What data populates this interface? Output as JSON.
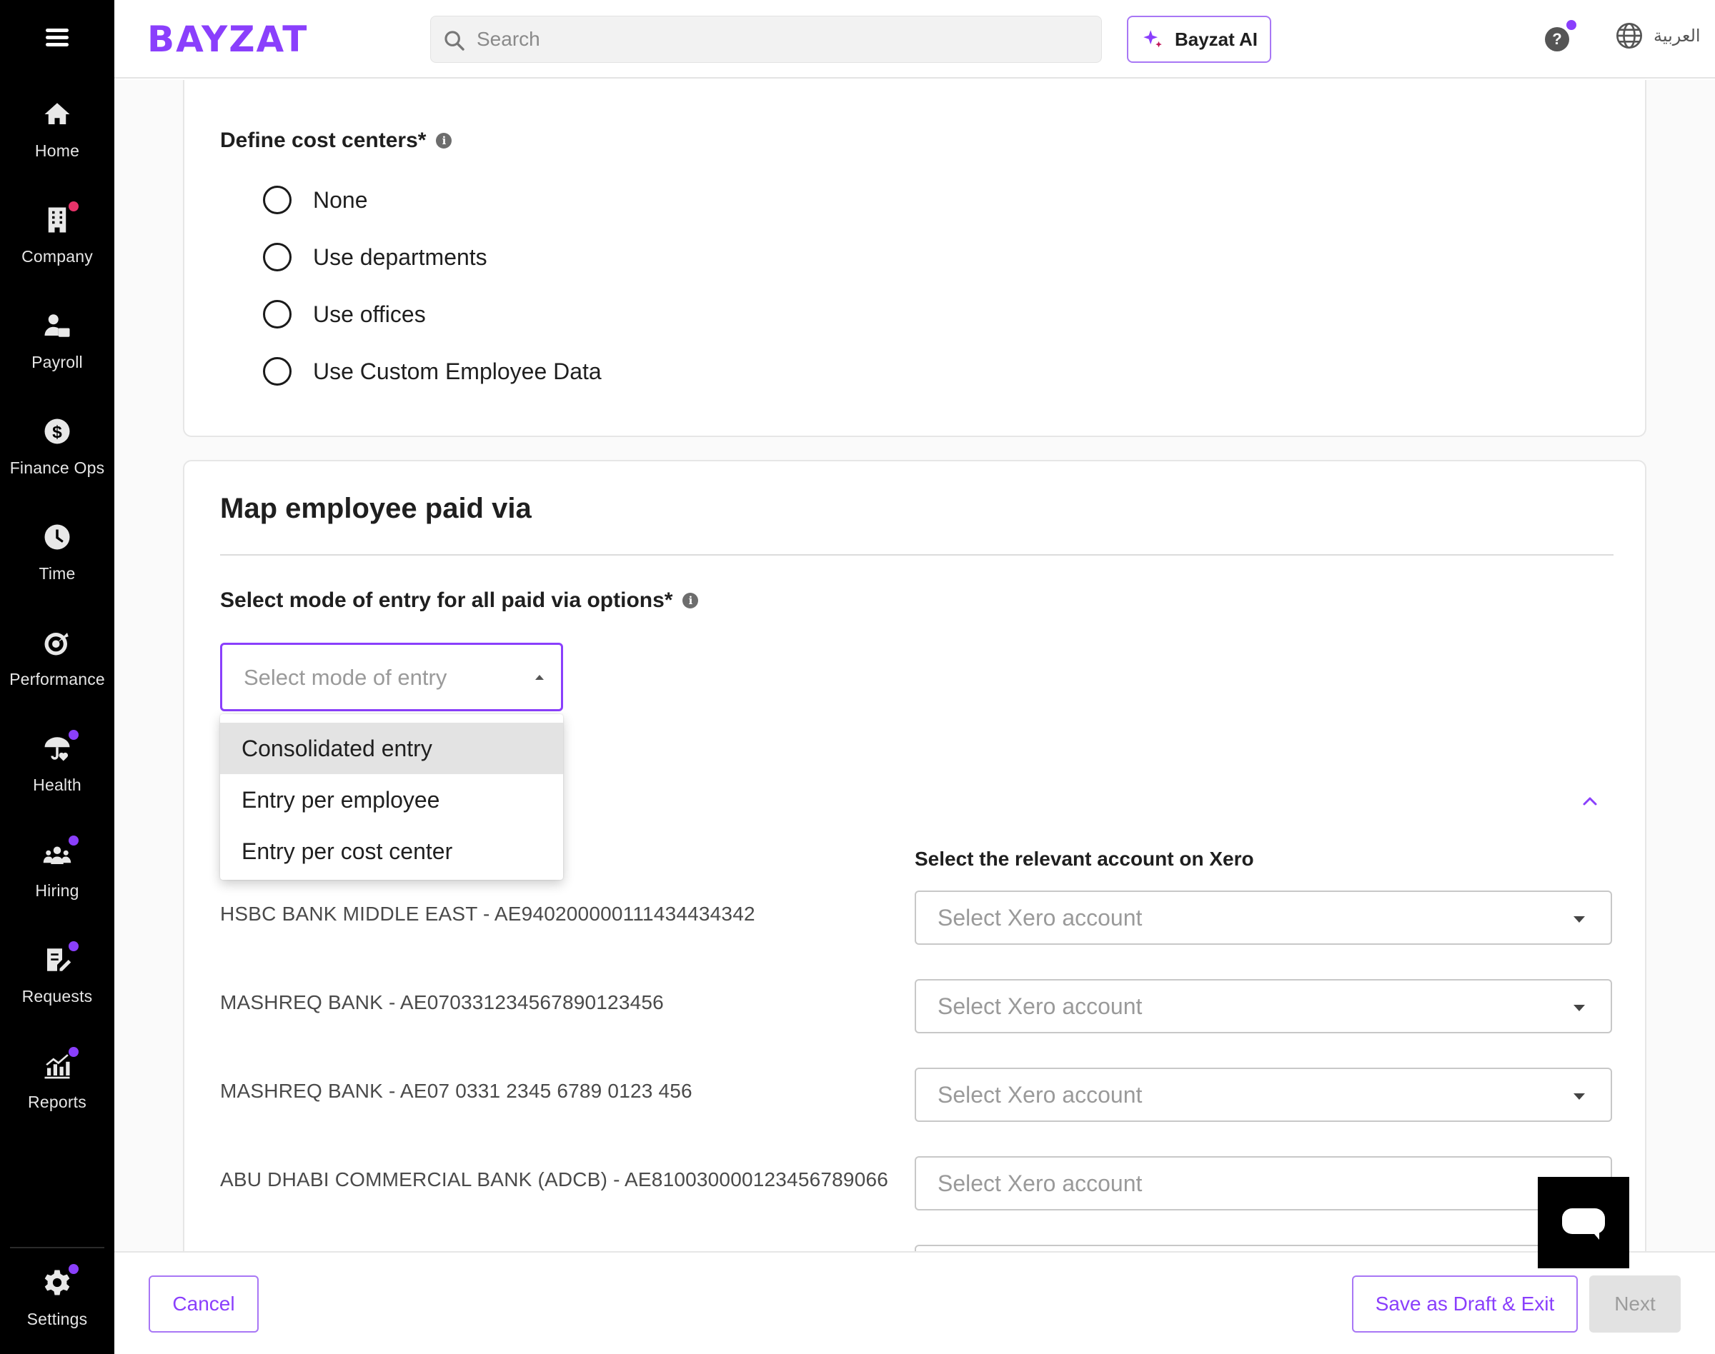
{
  "app": {
    "logo": "BAYZAT"
  },
  "sidebar": {
    "items": [
      {
        "label": "Home",
        "icon": "home-icon"
      },
      {
        "label": "Company",
        "icon": "building-icon",
        "badge": "#e8336a"
      },
      {
        "label": "Payroll",
        "icon": "payroll-icon"
      },
      {
        "label": "Finance Ops",
        "icon": "dollar-icon"
      },
      {
        "label": "Time",
        "icon": "clock-icon"
      },
      {
        "label": "Performance",
        "icon": "target-icon"
      },
      {
        "label": "Health",
        "icon": "umbrella-heart-icon",
        "badge": "#8a3ffc"
      },
      {
        "label": "Hiring",
        "icon": "people-icon",
        "badge": "#8a3ffc"
      },
      {
        "label": "Requests",
        "icon": "clipboard-icon",
        "badge": "#8a3ffc"
      },
      {
        "label": "Reports",
        "icon": "chart-icon",
        "badge": "#8a3ffc"
      }
    ],
    "settings": {
      "label": "Settings",
      "icon": "gear-icon"
    }
  },
  "topbar": {
    "search_placeholder": "Search",
    "ai_label": "Bayzat AI",
    "help_label": "?",
    "language_label": "العربية"
  },
  "cost_centers": {
    "label": "Define cost centers*",
    "options": [
      "None",
      "Use departments",
      "Use offices",
      "Use Custom Employee Data"
    ]
  },
  "paid_via": {
    "title": "Map employee paid via",
    "mode_label": "Select mode of entry for all paid via options*",
    "mode_placeholder": "Select mode of entry",
    "mode_options": [
      "Consolidated entry",
      "Entry per employee",
      "Entry per cost center"
    ],
    "highlighted_option": "Consolidated entry",
    "xero_column_label": "Select the relevant account on Xero",
    "xero_placeholder": "Select Xero account",
    "banks": [
      "HSBC BANK MIDDLE EAST - AE940200000111434434342",
      "MASHREQ BANK - AE070331234567890123456",
      "MASHREQ BANK - AE07 0331 2345 6789 0123 456",
      "ABU DHABI COMMERCIAL BANK (ADCB) - AE810030000123456789066"
    ]
  },
  "footer": {
    "cancel": "Cancel",
    "save_draft": "Save as Draft & Exit",
    "next": "Next"
  },
  "colors": {
    "brand": "#8a3ffc",
    "sidebar_bg": "#000000"
  }
}
